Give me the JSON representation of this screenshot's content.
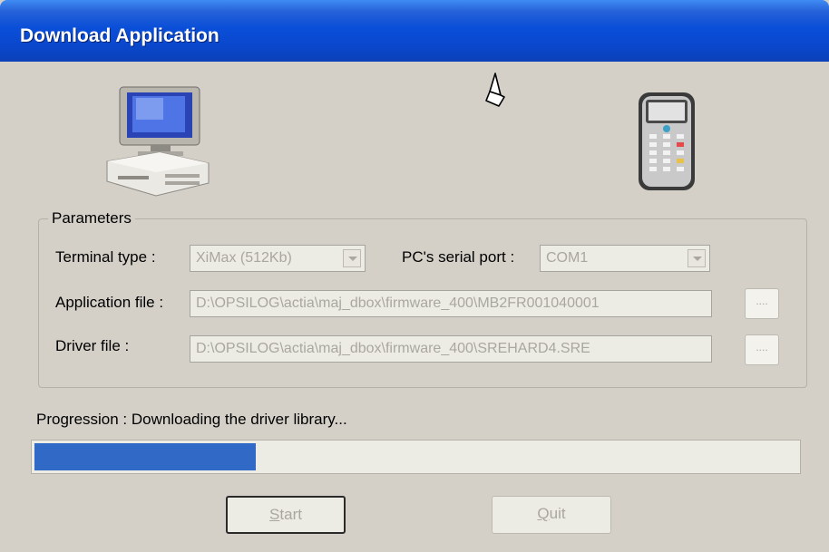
{
  "window": {
    "title": "Download Application"
  },
  "parameters": {
    "group_label": "Parameters",
    "terminal_type_label": "Terminal type :",
    "terminal_type_value": "XiMax (512Kb)",
    "serial_port_label": "PC's serial port :",
    "serial_port_value": "COM1",
    "application_file_label": "Application file :",
    "application_file_value": "D:\\OPSILOG\\actia\\maj_dbox\\firmware_400\\MB2FR001040001",
    "driver_file_label": "Driver file :",
    "driver_file_value": "D:\\OPSILOG\\actia\\maj_dbox\\firmware_400\\SREHARD4.SRE",
    "browse_label": "...."
  },
  "progress": {
    "label": "Progression : Downloading the driver library...",
    "percent": 29
  },
  "buttons": {
    "start": {
      "accel": "S",
      "rest": "tart"
    },
    "quit": {
      "accel": "Q",
      "rest": "uit"
    }
  },
  "icons": {
    "computer": "computer-icon",
    "terminal": "handheld-terminal-icon",
    "cursor": "mouse-cursor-icon"
  },
  "colors": {
    "progress_fill": "#3169c6",
    "titlebar": "#0a4fd8"
  }
}
